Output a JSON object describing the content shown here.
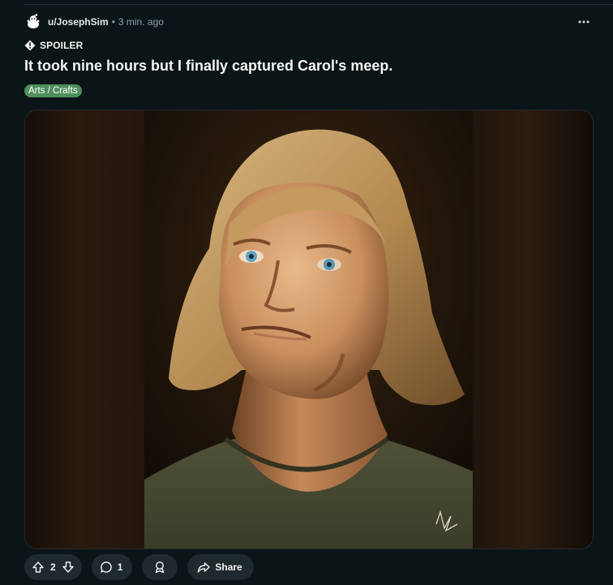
{
  "post": {
    "username": "u/JosephSim",
    "separator": "•",
    "time": "3 min. ago",
    "spoiler_label": "SPOILER",
    "title": "It took nine hours but I finally captured Carol's meep.",
    "flair": "Arts / Crafts",
    "flair_color": "#4f8f5e",
    "media_description": "digital painting portrait"
  },
  "actions": {
    "upvotes": "2",
    "comments": "1",
    "share_label": "Share"
  },
  "icons": {
    "avatar": "reddit-snoo-icon",
    "overflow": "more-horizontal-icon",
    "spoiler": "alert-icon",
    "upvote": "upvote-arrow-icon",
    "downvote": "downvote-arrow-icon",
    "comment": "comment-bubble-icon",
    "award": "award-icon",
    "share": "share-arrow-icon"
  },
  "colors": {
    "background": "#0b1416",
    "pill": "#1e2a2d",
    "meta": "#8ba2ad"
  }
}
